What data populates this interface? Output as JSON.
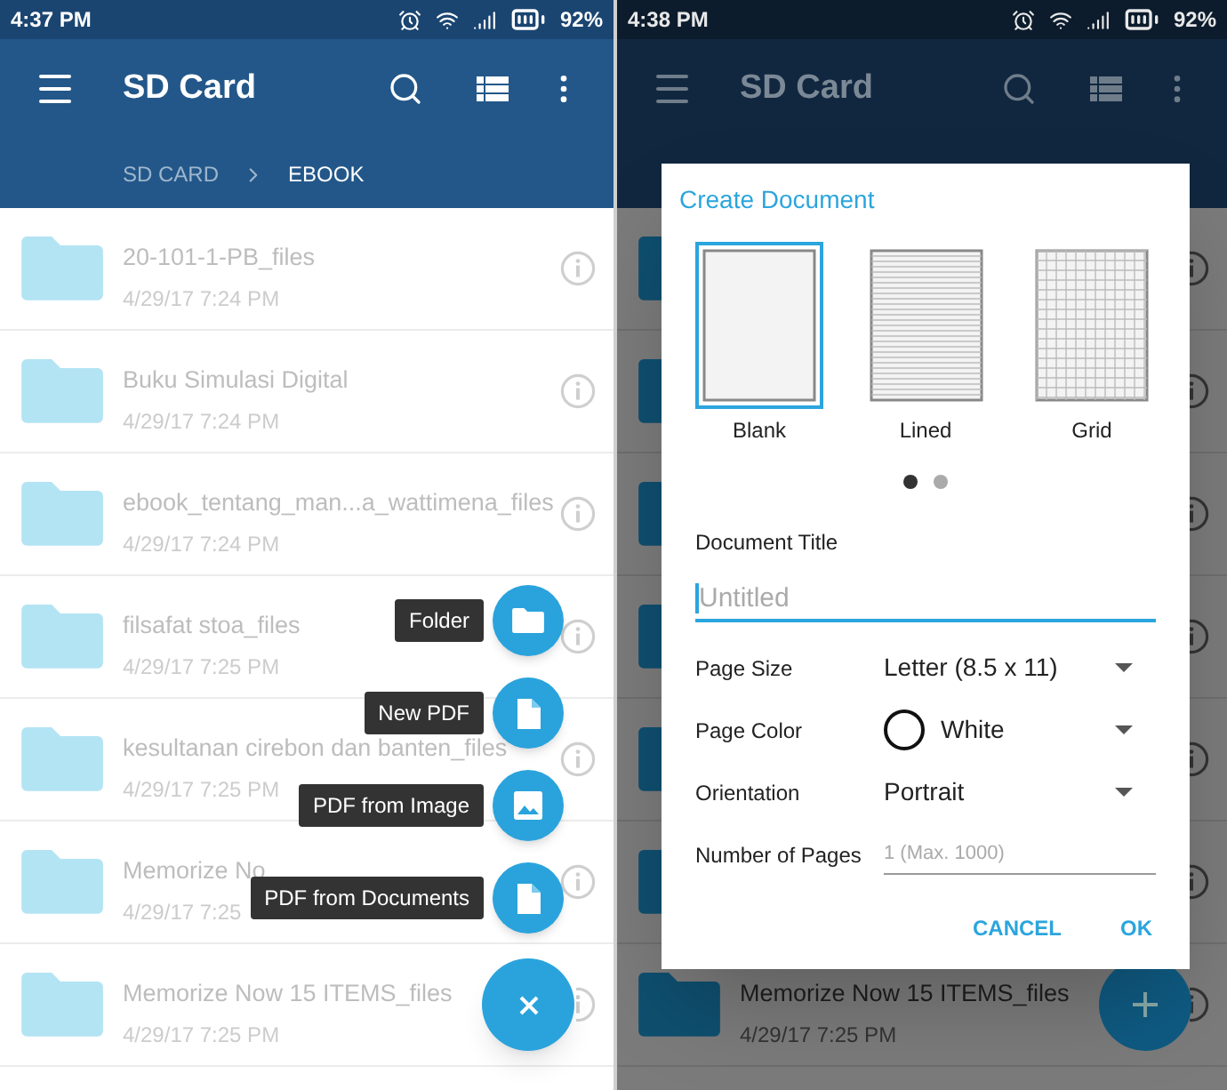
{
  "left_screen": {
    "status_bar": {
      "time": "4:37 PM",
      "battery": "92%"
    },
    "app_bar": {
      "title": "SD Card"
    },
    "breadcrumb": [
      {
        "label": "SD CARD",
        "selected": false
      },
      {
        "label": "EBOOK",
        "selected": true
      }
    ],
    "files": [
      {
        "name": "20-101-1-PB_files",
        "date": "4/29/17 7:24 PM"
      },
      {
        "name": "Buku Simulasi Digital",
        "date": "4/29/17 7:24 PM"
      },
      {
        "name": "ebook_tentang_man...a_wattimena_files",
        "date": "4/29/17 7:24 PM"
      },
      {
        "name": "filsafat stoa_files",
        "date": "4/29/17 7:25 PM"
      },
      {
        "name": "kesultanan cirebon dan banten_files",
        "date": "4/29/17 7:25 PM"
      },
      {
        "name": "Memorize No",
        "date": "4/29/17 7:25"
      },
      {
        "name": "Memorize Now 15 ITEMS_files",
        "date": "4/29/17 7:25 PM"
      }
    ],
    "fab_menu": [
      {
        "kind": "folder",
        "label": "Folder"
      },
      {
        "kind": "file",
        "label": "New PDF"
      },
      {
        "kind": "image",
        "label": "PDF from Image"
      },
      {
        "kind": "file",
        "label": "PDF from Documents"
      }
    ]
  },
  "right_screen": {
    "status_bar": {
      "time": "4:38 PM",
      "battery": "92%"
    },
    "app_bar": {
      "title": "SD Card"
    },
    "files": [
      {
        "name": "Memorize Now 15 ITEMS_files",
        "date": "4/29/17 7:25 PM"
      }
    ],
    "dialog": {
      "title": "Create Document",
      "templates": [
        {
          "kind": "blank",
          "label": "Blank",
          "selected": true
        },
        {
          "kind": "lined",
          "label": "Lined",
          "selected": false
        },
        {
          "kind": "grid",
          "label": "Grid",
          "selected": false
        }
      ],
      "pager": [
        {
          "selected": true
        },
        {
          "selected": false
        }
      ],
      "title_field": {
        "label": "Document Title",
        "placeholder": "Untitled",
        "focused": true
      },
      "settings": [
        {
          "kind": "dropdown",
          "label": "Page Size",
          "value": "Letter (8.5 x 11)"
        },
        {
          "kind": "color",
          "label": "Page Color",
          "value": "White",
          "color": "#ffffff"
        },
        {
          "kind": "dropdown",
          "label": "Orientation",
          "value": "Portrait"
        },
        {
          "kind": "input",
          "label": "Number of Pages",
          "placeholder": "1 (Max. 1000)"
        }
      ],
      "buttons": [
        "CANCEL",
        "OK"
      ]
    }
  }
}
